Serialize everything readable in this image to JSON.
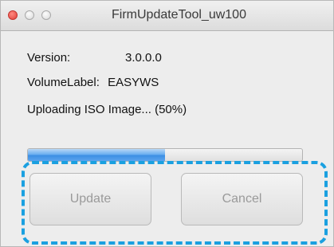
{
  "window": {
    "title": "FirmUpdateTool_uw100"
  },
  "info": {
    "version_label": "Version:",
    "version_value": "3.0.0.0",
    "volume_label": "VolumeLabel:",
    "volume_value": "EASYWS"
  },
  "status": {
    "text": "Uploading ISO Image... (50%)"
  },
  "progress": {
    "percent": 50
  },
  "buttons": {
    "update_label": "Update",
    "cancel_label": "Cancel"
  },
  "colors": {
    "highlight": "#1aa0e0",
    "progress_fill": "#3d8fe4"
  }
}
